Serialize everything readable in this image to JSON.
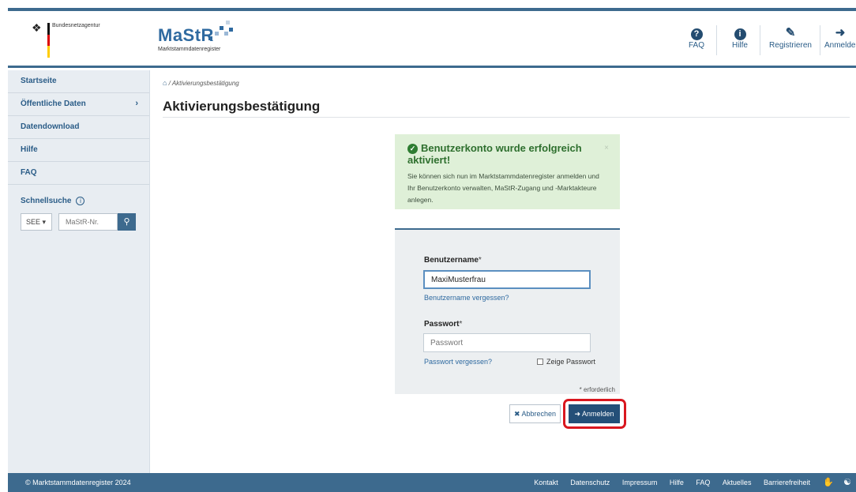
{
  "header": {
    "agency": "Bundesnetzagentur",
    "logo_title": "MaStR",
    "logo_subtitle": "Marktstammdatenregister",
    "nav": [
      {
        "label": "FAQ",
        "icon": "question-circle-icon"
      },
      {
        "label": "Hilfe",
        "icon": "info-circle-icon"
      },
      {
        "label": "Registrieren",
        "icon": "edit-icon"
      },
      {
        "label": "Anmelden",
        "icon": "sign-in-icon"
      }
    ],
    "colors": {
      "accent": "#3d6a8e",
      "brand_blue": "#2f6aa0"
    }
  },
  "sidebar": {
    "items": [
      {
        "label": "Startseite"
      },
      {
        "label": "Öffentliche Daten"
      },
      {
        "label": "Datendownload"
      },
      {
        "label": "Hilfe"
      },
      {
        "label": "FAQ"
      }
    ],
    "quicksearch": {
      "label": "Schnellsuche",
      "select_value": "SEE",
      "placeholder": "MaStR-Nr."
    }
  },
  "breadcrumb": {
    "current": "Aktivierungsbestätigung"
  },
  "page": {
    "title": "Aktivierungsbestätigung"
  },
  "alert": {
    "title": "Benutzerkonto wurde erfolgreich aktiviert!",
    "text": "Sie können sich nun im Marktstammdatenregister anmelden und Ihr Benutzerkonto verwalten, MaStR-Zugang und -Marktakteure anlegen.",
    "color": "#dff0d8"
  },
  "login": {
    "username_label": "Benutzername",
    "username_value": "MaxiMusterfrau",
    "forgot_username": "Benutzername vergessen?",
    "password_label": "Passwort",
    "password_placeholder": "Passwort",
    "forgot_password": "Passwort vergessen?",
    "show_password": "Zeige Passwort",
    "required_marker": "*",
    "required_note": "* erforderlich",
    "cancel_label": "Abbrechen",
    "submit_label": "Anmelden",
    "highlight_color": "#d9171f"
  },
  "footer": {
    "copyright": "© Marktstammdatenregister 2024",
    "links": [
      "Kontakt",
      "Datenschutz",
      "Impressum",
      "Hilfe",
      "FAQ",
      "Aktuelles",
      "Barrierefreiheit"
    ]
  }
}
